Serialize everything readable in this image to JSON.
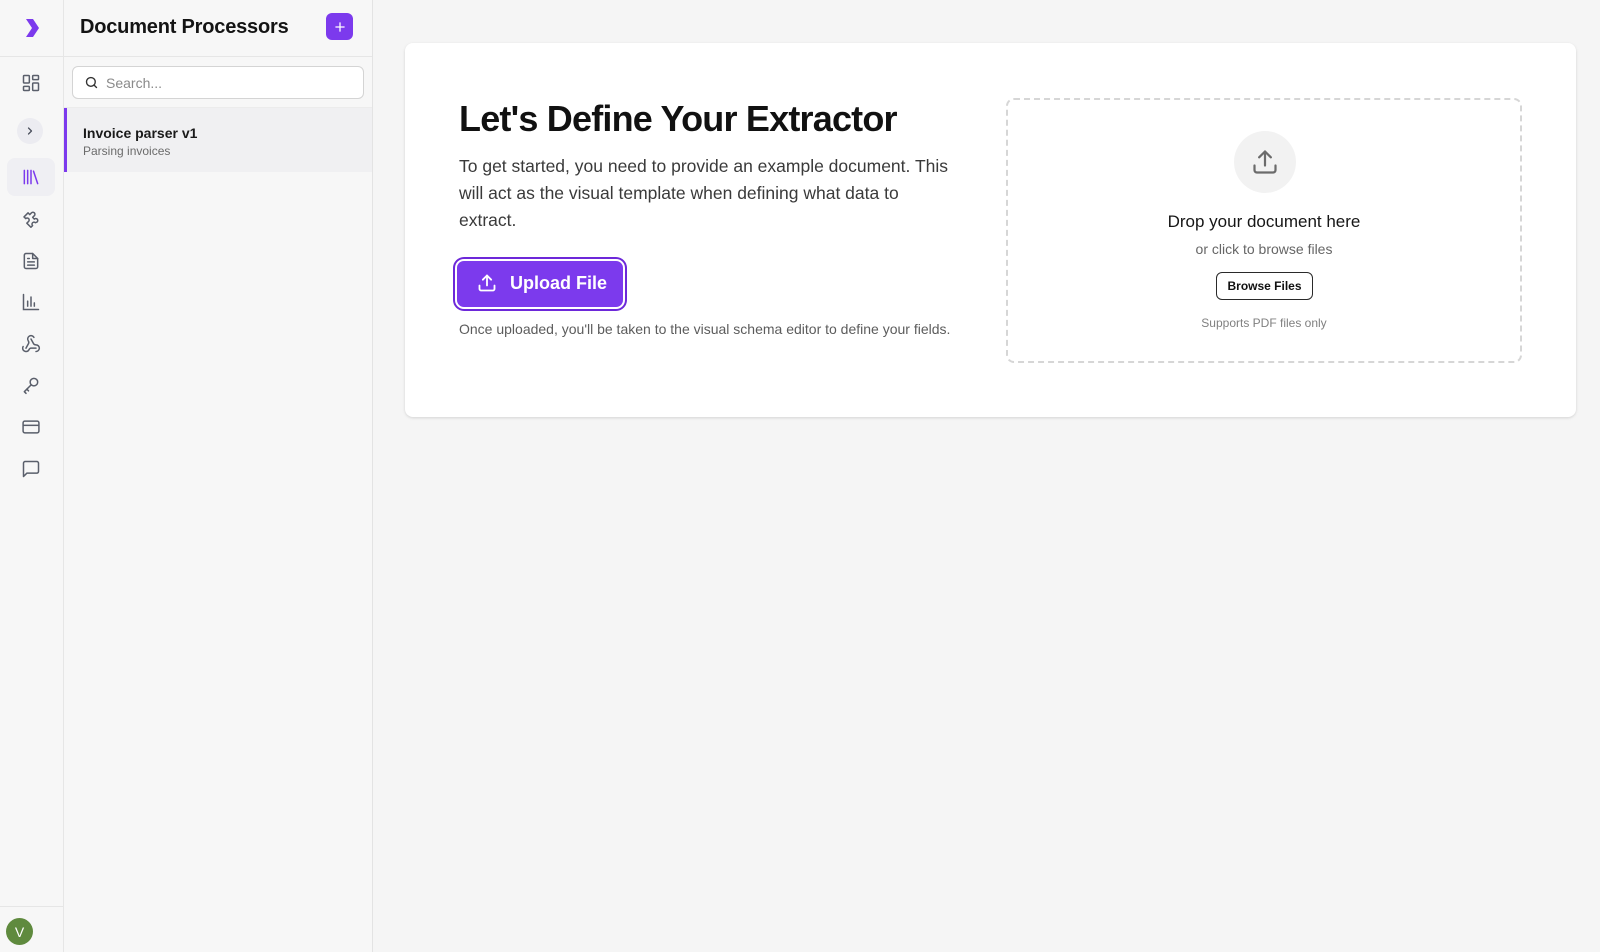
{
  "colors": {
    "accent": "#7c3aed",
    "accent_dark": "#6d28d9",
    "avatar": "#5f8a3e",
    "background": "#f5f5f5",
    "card": "#ffffff"
  },
  "rail": {
    "logo_icon": "chevron-logo-icon",
    "items": [
      {
        "icon": "dashboard-grid-icon",
        "active": false
      },
      {
        "icon": "library-icon",
        "active": true
      },
      {
        "icon": "puzzle-icon",
        "active": false
      },
      {
        "icon": "document-icon",
        "active": false
      },
      {
        "icon": "bar-chart-icon",
        "active": false
      },
      {
        "icon": "webhook-icon",
        "active": false
      },
      {
        "icon": "key-icon",
        "active": false
      },
      {
        "icon": "credit-card-icon",
        "active": false
      },
      {
        "icon": "message-icon",
        "active": false
      }
    ],
    "toggle_icon": "chevron-right-icon",
    "avatar_initial": "V"
  },
  "panel": {
    "title": "Document Processors",
    "add_icon": "plus-icon",
    "search": {
      "placeholder": "Search...",
      "value": ""
    },
    "items": [
      {
        "title": "Invoice parser v1",
        "subtitle": "Parsing invoices",
        "selected": true
      }
    ]
  },
  "main": {
    "heading": "Let's Define Your Extractor",
    "intro": "To get started, you need to provide an example document. This will act as the visual template when defining what data to extract.",
    "upload_button": "Upload File",
    "note": "Once uploaded, you'll be taken to the visual schema editor to define your fields.",
    "dropzone": {
      "icon": "upload-icon",
      "title": "Drop your document here",
      "subtitle": "or click to browse files",
      "browse_button": "Browse Files",
      "hint": "Supports PDF files only"
    }
  }
}
